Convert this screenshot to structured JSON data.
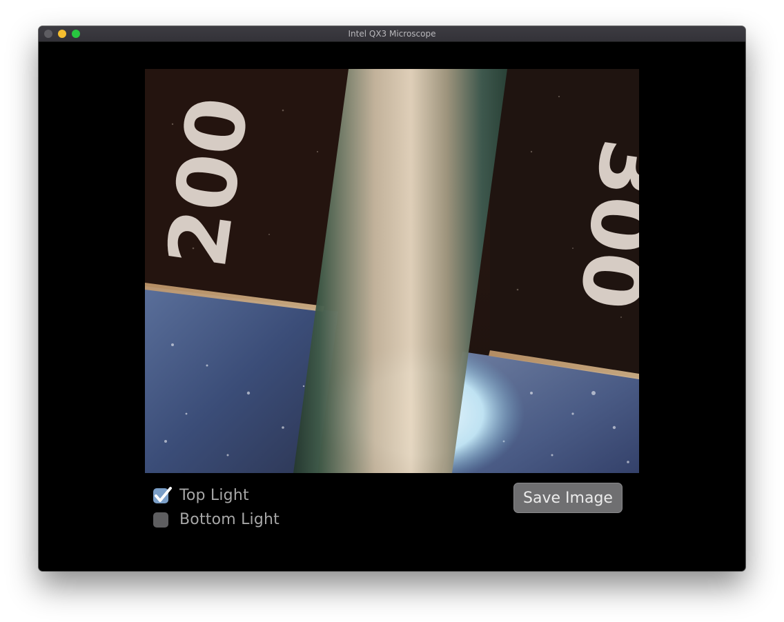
{
  "window": {
    "title": "Intel QX3 Microscope"
  },
  "viewport": {
    "numbers_left": "200",
    "numbers_right": "300"
  },
  "controls": {
    "top_light": {
      "label": "Top Light",
      "checked": true
    },
    "bottom_light": {
      "label": "Bottom Light",
      "checked": false
    },
    "save_label": "Save Image"
  },
  "colors": {
    "checkbox_on": "#7a9ec7",
    "checkbox_off": "#5e5e60",
    "button_bg": "#6f6f71"
  }
}
